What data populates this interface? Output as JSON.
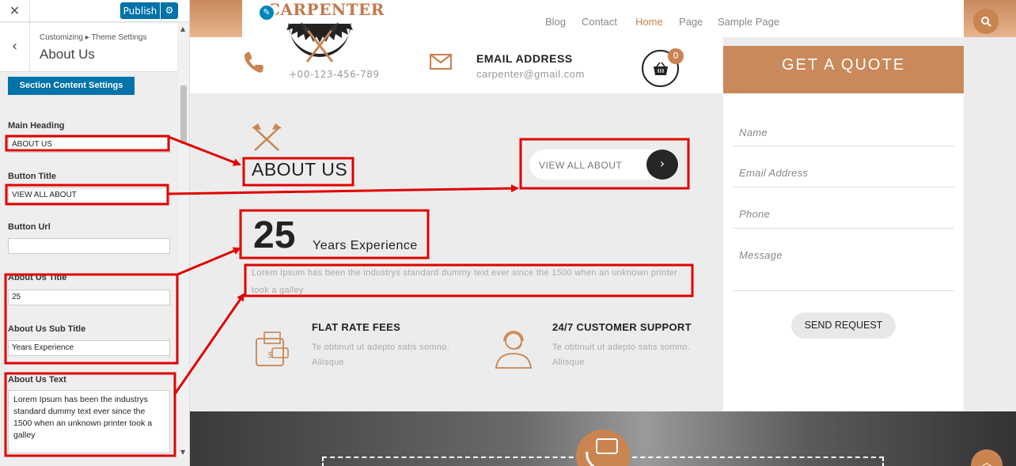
{
  "customizer": {
    "close_glyph": "✕",
    "publish_label": "Publish",
    "publish_gear_glyph": "⚙",
    "back_glyph": "‹",
    "breadcrumb": "Customizing ▸ Theme Settings",
    "section_title": "About Us",
    "section_button": "Section Content Settings",
    "fields": {
      "main_heading": {
        "label": "Main Heading",
        "value": "ABOUT US"
      },
      "button_title": {
        "label": "Button Title",
        "value": "VIEW ALL ABOUT"
      },
      "button_url": {
        "label": "Button Url",
        "value": ""
      },
      "about_title": {
        "label": "About Us Title",
        "value": "25"
      },
      "about_subtitle": {
        "label": "About Us Sub Title",
        "value": "Years Experience"
      },
      "about_text": {
        "label": "About Us Text",
        "value": "Lorem Ipsum has been the industrys standard dummy text ever since the 1500 when an unknown printer took a galley"
      }
    }
  },
  "site": {
    "logo_text": "CARPENTER",
    "nav": [
      "Blog",
      "Contact",
      "Home",
      "Page",
      "Sample Page"
    ],
    "active_nav": "Home",
    "phone": "+00-123-456-789",
    "email_heading": "EMAIL ADDRESS",
    "email": "carpenter@gmail.com",
    "cart_count": "0",
    "quote_title": "GET A QUOTE",
    "form": {
      "name_ph": "Name",
      "email_ph": "Email Address",
      "phone_ph": "Phone",
      "message_ph": "Message",
      "send_label": "SEND REQUEST"
    },
    "about": {
      "heading": "ABOUT US",
      "button": "VIEW ALL ABOUT",
      "years": "25",
      "years_sub": "Years Experience",
      "text": "Lorem Ipsum has been the industrys standard dummy text ever since the 1500 when an unknown printer took a galley",
      "features": [
        {
          "title": "FLAT RATE FEES",
          "text": "Te obtinuit ut adepto satis somno. Aliisque",
          "icon": "wallet-icon"
        },
        {
          "title": "24/7 CUSTOMER SUPPORT",
          "text": "Te obtinuit ut adepto satis somno. Aliisque",
          "icon": "support-agent-icon"
        }
      ]
    }
  },
  "colors": {
    "accent": "#c98450",
    "wp_blue": "#0073aa",
    "annotation": "#e00000"
  }
}
